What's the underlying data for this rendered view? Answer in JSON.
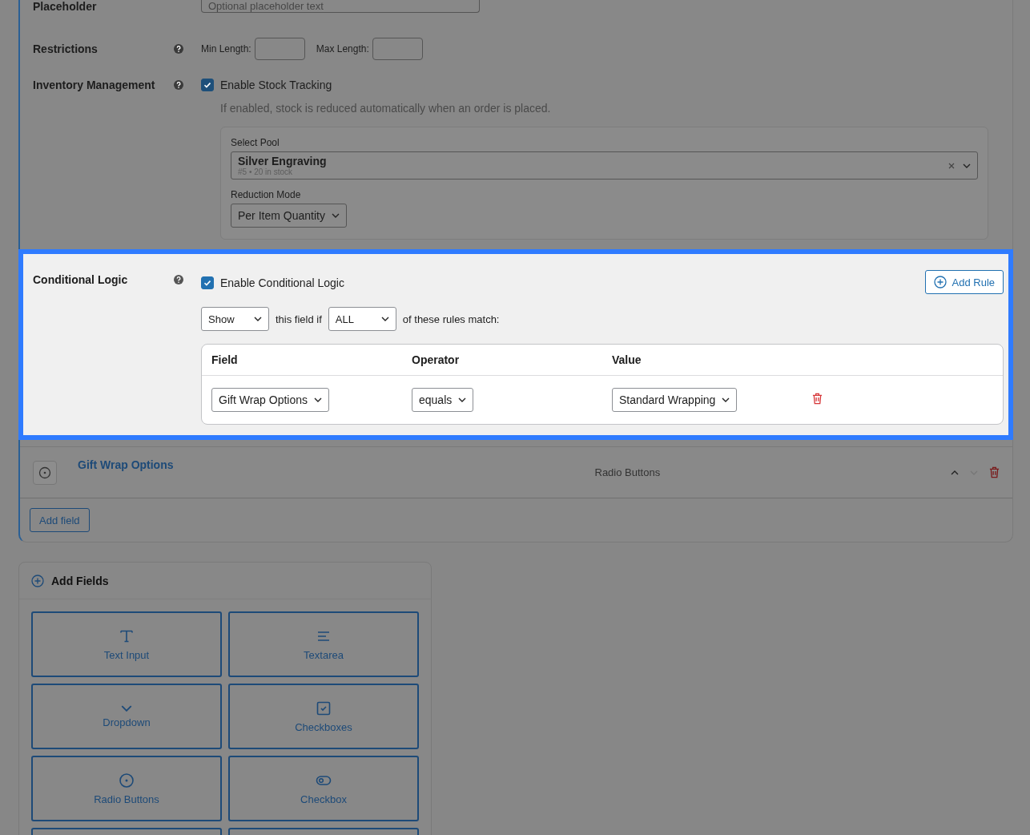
{
  "placeholder_row": {
    "label": "Placeholder",
    "placeholder": "Optional placeholder text"
  },
  "restrictions": {
    "label": "Restrictions",
    "min_label": "Min Length:",
    "max_label": "Max Length:"
  },
  "inventory": {
    "label": "Inventory Management",
    "checkbox": {
      "label": "Enable Stock Tracking",
      "checked": true
    },
    "hint": "If enabled, stock is reduced automatically when an order is placed.",
    "pool": {
      "label": "Select Pool",
      "value": "Silver Engraving",
      "meta": "#5 • 20 in stock"
    },
    "reduction": {
      "label": "Reduction Mode",
      "value": "Per Item Quantity"
    }
  },
  "conditional_logic": {
    "label": "Conditional Logic",
    "checkbox": {
      "label": "Enable Conditional Logic",
      "checked": true
    },
    "add_rule": "Add Rule",
    "action": "Show",
    "connector": "this field if",
    "match": "ALL",
    "suffix": "of these rules match:",
    "table": {
      "columns": [
        "Field",
        "Operator",
        "Value"
      ],
      "rows": [
        {
          "field": "Gift Wrap Options",
          "operator": "equals",
          "value": "Standard Wrapping"
        }
      ]
    }
  },
  "fields_list": [
    {
      "name": "Gift Wrap Options",
      "type": "Radio Buttons"
    }
  ],
  "add_field_button": "Add field",
  "add_fields": {
    "title": "Add Fields",
    "items": [
      {
        "label": "Text Input",
        "kind": "text"
      },
      {
        "label": "Textarea",
        "kind": "textarea"
      },
      {
        "label": "Dropdown",
        "kind": "dropdown"
      },
      {
        "label": "Checkboxes",
        "kind": "checkboxes"
      },
      {
        "label": "Radio Buttons",
        "kind": "radio"
      },
      {
        "label": "Checkbox",
        "kind": "toggle"
      }
    ]
  }
}
